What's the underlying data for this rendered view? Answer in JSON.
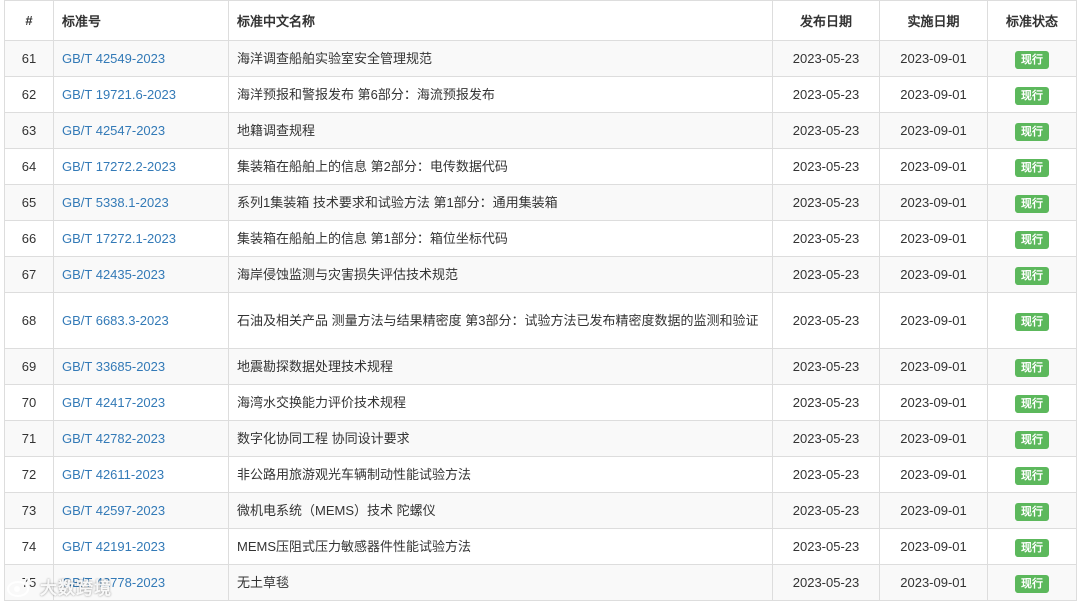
{
  "table": {
    "headers": {
      "num": "#",
      "code": "标准号",
      "name": "标准中文名称",
      "publish": "发布日期",
      "implement": "实施日期",
      "status": "标准状态"
    },
    "rows": [
      {
        "num": "61",
        "code": "GB/T 42549-2023",
        "name": "海洋调查船舶实验室安全管理规范",
        "publish": "2023-05-23",
        "implement": "2023-09-01",
        "status": "现行"
      },
      {
        "num": "62",
        "code": "GB/T 19721.6-2023",
        "name": "海洋预报和警报发布 第6部分：海流预报发布",
        "publish": "2023-05-23",
        "implement": "2023-09-01",
        "status": "现行"
      },
      {
        "num": "63",
        "code": "GB/T 42547-2023",
        "name": "地籍调查规程",
        "publish": "2023-05-23",
        "implement": "2023-09-01",
        "status": "现行"
      },
      {
        "num": "64",
        "code": "GB/T 17272.2-2023",
        "name": "集装箱在船舶上的信息 第2部分：电传数据代码",
        "publish": "2023-05-23",
        "implement": "2023-09-01",
        "status": "现行"
      },
      {
        "num": "65",
        "code": "GB/T 5338.1-2023",
        "name": "系列1集装箱 技术要求和试验方法 第1部分：通用集装箱",
        "publish": "2023-05-23",
        "implement": "2023-09-01",
        "status": "现行"
      },
      {
        "num": "66",
        "code": "GB/T 17272.1-2023",
        "name": "集装箱在船舶上的信息 第1部分：箱位坐标代码",
        "publish": "2023-05-23",
        "implement": "2023-09-01",
        "status": "现行"
      },
      {
        "num": "67",
        "code": "GB/T 42435-2023",
        "name": "海岸侵蚀监测与灾害损失评估技术规范",
        "publish": "2023-05-23",
        "implement": "2023-09-01",
        "status": "现行"
      },
      {
        "num": "68",
        "code": "GB/T 6683.3-2023",
        "name": "石油及相关产品 测量方法与结果精密度 第3部分：试验方法已发布精密度数据的监测和验证",
        "publish": "2023-05-23",
        "implement": "2023-09-01",
        "status": "现行"
      },
      {
        "num": "69",
        "code": "GB/T 33685-2023",
        "name": "地震勘探数据处理技术规程",
        "publish": "2023-05-23",
        "implement": "2023-09-01",
        "status": "现行"
      },
      {
        "num": "70",
        "code": "GB/T 42417-2023",
        "name": "海湾水交换能力评价技术规程",
        "publish": "2023-05-23",
        "implement": "2023-09-01",
        "status": "现行"
      },
      {
        "num": "71",
        "code": "GB/T 42782-2023",
        "name": "数字化协同工程 协同设计要求",
        "publish": "2023-05-23",
        "implement": "2023-09-01",
        "status": "现行"
      },
      {
        "num": "72",
        "code": "GB/T 42611-2023",
        "name": "非公路用旅游观光车辆制动性能试验方法",
        "publish": "2023-05-23",
        "implement": "2023-09-01",
        "status": "现行"
      },
      {
        "num": "73",
        "code": "GB/T 42597-2023",
        "name": "微机电系统（MEMS）技术 陀螺仪",
        "publish": "2023-05-23",
        "implement": "2023-09-01",
        "status": "现行"
      },
      {
        "num": "74",
        "code": "GB/T 42191-2023",
        "name": "MEMS压阻式压力敏感器件性能试验方法",
        "publish": "2023-05-23",
        "implement": "2023-09-01",
        "status": "现行"
      },
      {
        "num": "75",
        "code": "GB/T 42778-2023",
        "name": "无土草毯",
        "publish": "2023-05-23",
        "implement": "2023-09-01",
        "status": "现行"
      }
    ]
  },
  "watermark": {
    "text": "大数跨境",
    "icon": "weibo-logo-icon"
  },
  "colors": {
    "link": "#337ab7",
    "badge": "#5cb85c",
    "stripe": "#f9f9f9",
    "border": "#dddddd"
  }
}
